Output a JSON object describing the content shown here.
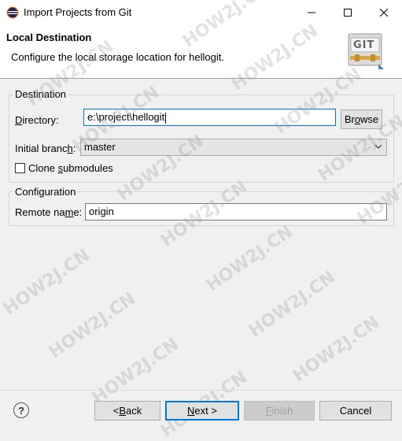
{
  "window": {
    "title": "Import Projects from Git"
  },
  "header": {
    "title": "Local Destination",
    "description": "Configure the local storage location for hellogit.",
    "logo_text": "GIT"
  },
  "destination": {
    "group_title": "Destination",
    "directory_label_u": "D",
    "directory_label_rest": "irectory:",
    "directory_value": "e:\\project\\hellogit",
    "browse_label_pre": "Br",
    "browse_label_u": "o",
    "browse_label_post": "wse",
    "branch_label_pre": "Initial branc",
    "branch_label_u": "h",
    "branch_label_post": ":",
    "branch_value": "master",
    "clone_label_pre": "Clone ",
    "clone_label_u": "s",
    "clone_label_post": "ubmodules",
    "clone_checked": false
  },
  "configuration": {
    "group_title": "Configuration",
    "remote_label_pre": "Remote na",
    "remote_label_u": "m",
    "remote_label_post": "e:",
    "remote_value": "origin"
  },
  "footer": {
    "help_symbol": "?",
    "back_pre": "< ",
    "back_u": "B",
    "back_post": "ack",
    "next_u": "N",
    "next_post": "ext >",
    "finish_u": "F",
    "finish_post": "inish",
    "cancel_label": "Cancel"
  },
  "watermark": "HOW2J.CN",
  "icons": {
    "app": "eclipse-icon",
    "minimize": "minimize-icon",
    "maximize": "maximize-icon",
    "close": "close-icon",
    "dropdown": "chevron-down-icon",
    "help": "help-icon"
  }
}
